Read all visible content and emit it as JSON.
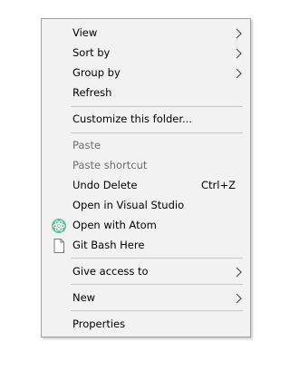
{
  "context_menu": {
    "items": [
      {
        "label": "View",
        "has_submenu": true
      },
      {
        "label": "Sort by",
        "has_submenu": true
      },
      {
        "label": "Group by",
        "has_submenu": true
      },
      {
        "label": "Refresh"
      },
      {
        "label": "Customize this folder..."
      },
      {
        "label": "Paste",
        "disabled": true
      },
      {
        "label": "Paste shortcut",
        "disabled": true
      },
      {
        "label": "Undo Delete",
        "shortcut": "Ctrl+Z"
      },
      {
        "label": "Open in Visual Studio"
      },
      {
        "label": "Open with Atom",
        "icon": "atom-icon"
      },
      {
        "label": "Git Bash Here",
        "icon": "document-icon"
      },
      {
        "label": "Give access to",
        "has_submenu": true
      },
      {
        "label": "New",
        "has_submenu": true
      },
      {
        "label": "Properties"
      }
    ]
  },
  "colors": {
    "menu_background": "#f2f2f2",
    "disabled_text": "#6d6d6d",
    "separator": "#c8c8c8",
    "atom_icon": "#5fbf98"
  }
}
